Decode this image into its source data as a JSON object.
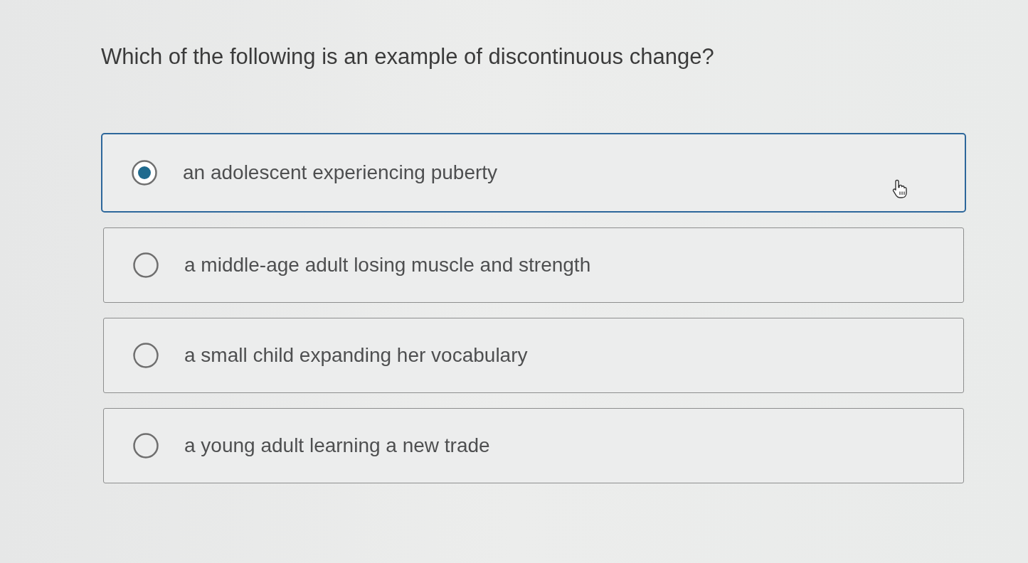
{
  "question": "Which of the following is an example of discontinuous change?",
  "options": [
    {
      "label": "an adolescent experiencing puberty",
      "selected": true
    },
    {
      "label": "a middle-age adult losing muscle and strength",
      "selected": false
    },
    {
      "label": "a small child expanding her vocabulary",
      "selected": false
    },
    {
      "label": "a young adult learning a new trade",
      "selected": false
    }
  ]
}
